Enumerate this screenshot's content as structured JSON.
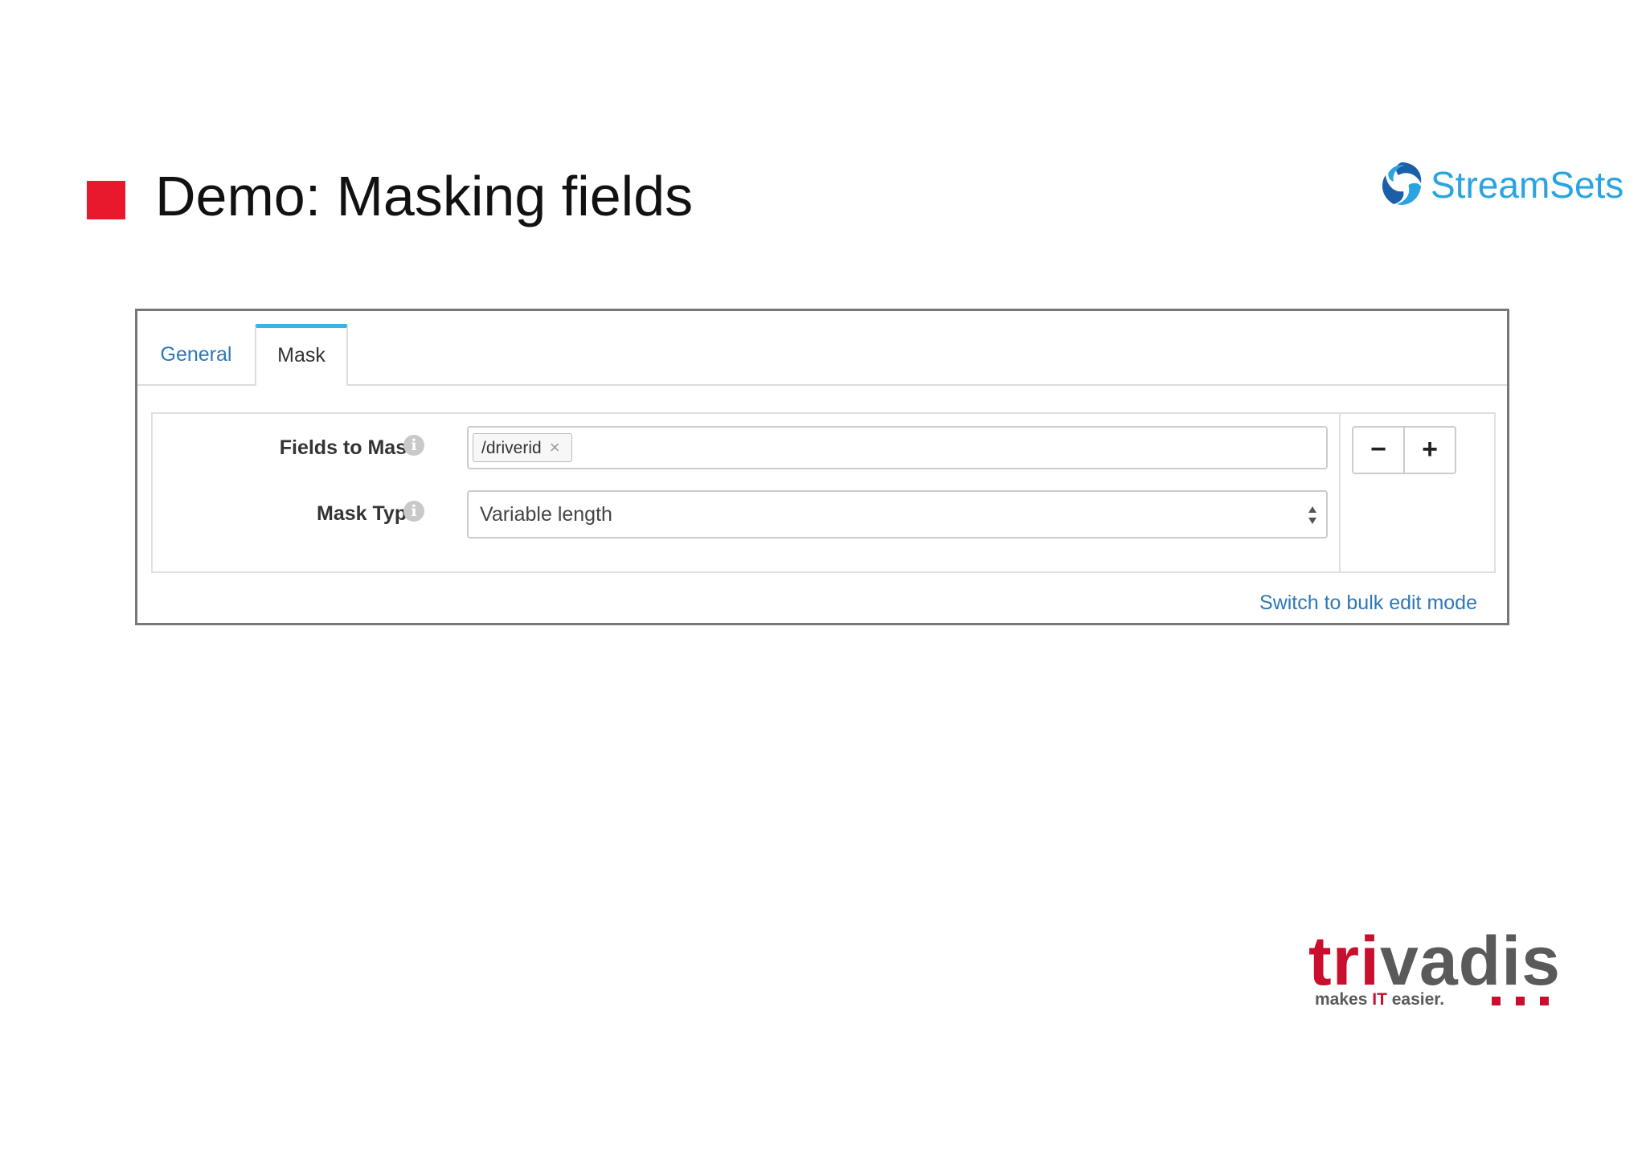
{
  "slide": {
    "title": "Demo: Masking fields"
  },
  "logos": {
    "streamsets": "StreamSets",
    "trivadis": {
      "word_red": "tri",
      "word_grey": "vadis",
      "tagline_pre": "makes ",
      "tagline_hl": "IT",
      "tagline_post": " easier."
    }
  },
  "tabs": [
    {
      "label": "General",
      "active": false
    },
    {
      "label": "Mask",
      "active": true
    }
  ],
  "form": {
    "fields_label": "Fields to Mask",
    "fields_tag": "/driverid",
    "tag_remove": "×",
    "mask_type_label": "Mask Type",
    "mask_type_value": "Variable length",
    "info_glyph": "i",
    "minus_label": "−",
    "plus_label": "+"
  },
  "bulk_edit_link": "Switch to bulk edit mode",
  "colors": {
    "accent_red": "#e8192c",
    "link_blue": "#2e78b8",
    "tab_active": "#38b4e6",
    "streamsets_blue": "#2aa4e0"
  },
  "icons": [
    "info-icon",
    "close-icon",
    "select-arrows-icon",
    "minus-icon",
    "plus-icon",
    "streamsets-logo-icon"
  ]
}
